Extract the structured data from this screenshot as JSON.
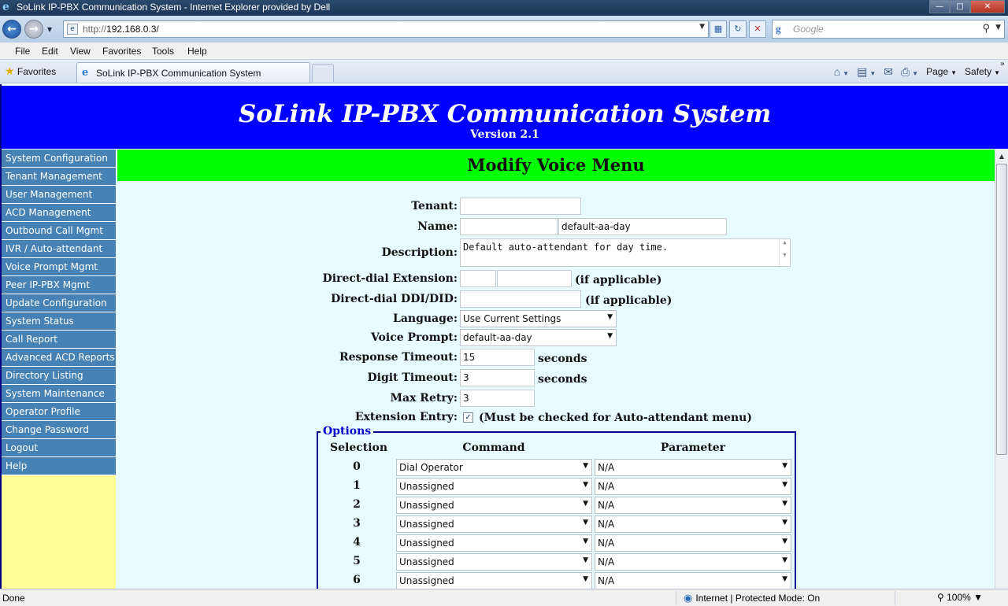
{
  "window": {
    "title": "SoLink IP-PBX Communication System - Internet Explorer provided by Dell"
  },
  "nav": {
    "url_prefix": "http://",
    "url_host": "192.168.0.3/",
    "search_placeholder": "Google"
  },
  "menu": [
    "File",
    "Edit",
    "View",
    "Favorites",
    "Tools",
    "Help"
  ],
  "favbar": {
    "favorites_label": "Favorites",
    "tab_title": "SoLink IP-PBX Communication System",
    "page_label": "Page",
    "safety_label": "Safety"
  },
  "header": {
    "title": "SoLink IP-PBX Communication System",
    "version": "Version 2.1"
  },
  "sidebar": {
    "items": [
      "System Configuration",
      "Tenant Management",
      "User Management",
      "ACD Management",
      "Outbound Call Mgmt",
      "IVR / Auto-attendant",
      "Voice Prompt Mgmt",
      "Peer IP-PBX Mgmt",
      "Update Configuration",
      "System Status",
      "Call Report",
      "Advanced ACD Reports",
      "Directory Listing",
      "System Maintenance",
      "Operator Profile",
      "Change Password",
      "Logout",
      "Help"
    ]
  },
  "form": {
    "heading": "Modify Voice Menu",
    "tenant_label": "Tenant:",
    "tenant_value": "",
    "name_label": "Name:",
    "name_prefix_value": "",
    "name_value": "default-aa-day",
    "description_label": "Description:",
    "description_value": "Default auto-attendant for day time.",
    "dde_label": "Direct-dial Extension:",
    "dde_prefix_value": "",
    "dde_value": "",
    "dde_note": "(if applicable)",
    "ddi_label": "Direct-dial DDI/DID:",
    "ddi_value": "",
    "ddi_note": "(if applicable)",
    "language_label": "Language:",
    "language_value": "Use Current Settings",
    "voice_prompt_label": "Voice Prompt:",
    "voice_prompt_value": "default-aa-day",
    "response_timeout_label": "Response Timeout:",
    "response_timeout_value": "15",
    "digit_timeout_label": "Digit Timeout:",
    "digit_timeout_value": "3",
    "seconds_label": "seconds",
    "max_retry_label": "Max Retry:",
    "max_retry_value": "3",
    "extension_entry_label": "Extension Entry:",
    "extension_entry_checked": true,
    "extension_entry_note": "(Must be checked for Auto-attendant menu)"
  },
  "options": {
    "legend": "Options",
    "headers": {
      "selection": "Selection",
      "command": "Command",
      "parameter": "Parameter"
    },
    "rows": [
      {
        "selection": "0",
        "command": "Dial Operator",
        "parameter": "N/A"
      },
      {
        "selection": "1",
        "command": "Unassigned",
        "parameter": "N/A"
      },
      {
        "selection": "2",
        "command": "Unassigned",
        "parameter": "N/A"
      },
      {
        "selection": "3",
        "command": "Unassigned",
        "parameter": "N/A"
      },
      {
        "selection": "4",
        "command": "Unassigned",
        "parameter": "N/A"
      },
      {
        "selection": "5",
        "command": "Unassigned",
        "parameter": "N/A"
      },
      {
        "selection": "6",
        "command": "Unassigned",
        "parameter": "N/A"
      }
    ]
  },
  "status": {
    "left": "Done",
    "zone": "Internet | Protected Mode: On",
    "zoom": "100%"
  }
}
